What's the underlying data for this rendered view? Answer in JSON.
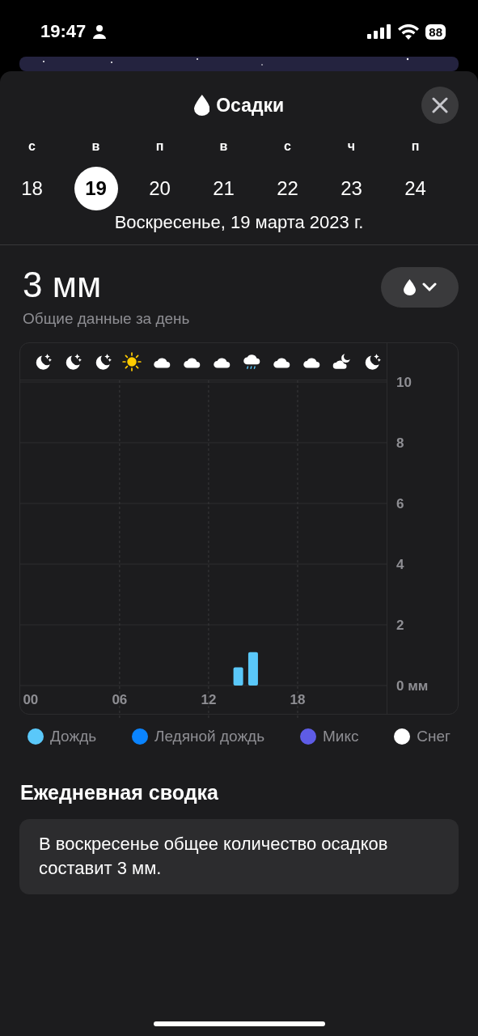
{
  "status_bar": {
    "time": "19:47",
    "battery": "88"
  },
  "sheet": {
    "title": "Осадки"
  },
  "days": [
    {
      "letter": "с",
      "number": "18",
      "selected": false
    },
    {
      "letter": "в",
      "number": "19",
      "selected": true
    },
    {
      "letter": "п",
      "number": "20",
      "selected": false
    },
    {
      "letter": "в",
      "number": "21",
      "selected": false
    },
    {
      "letter": "с",
      "number": "22",
      "selected": false
    },
    {
      "letter": "ч",
      "number": "23",
      "selected": false
    },
    {
      "letter": "п",
      "number": "24",
      "selected": false
    }
  ],
  "date": "Воскресенье, 19 марта 2023 г.",
  "total": {
    "value": "3 мм",
    "caption": "Общие данные за день"
  },
  "hourly_icons": [
    {
      "kind": "moon"
    },
    {
      "kind": "moon"
    },
    {
      "kind": "moon"
    },
    {
      "kind": "sun"
    },
    {
      "kind": "cloud"
    },
    {
      "kind": "cloud"
    },
    {
      "kind": "cloud"
    },
    {
      "kind": "rain"
    },
    {
      "kind": "cloud"
    },
    {
      "kind": "cloud"
    },
    {
      "kind": "cloud-moon"
    },
    {
      "kind": "moon"
    }
  ],
  "chart_data": {
    "type": "bar",
    "grid": true,
    "x": [
      14,
      15
    ],
    "series": [
      {
        "name": "Дождь",
        "color": "#5ac8fa",
        "values": [
          0.6,
          1.1
        ]
      },
      {
        "name": "Ледяной дождь",
        "color": "#0a84ff",
        "values": [
          0,
          0
        ]
      },
      {
        "name": "Микс",
        "color": "#5e5ce6",
        "values": [
          0,
          0
        ]
      },
      {
        "name": "Снег",
        "color": "#ffffff",
        "values": [
          0,
          0
        ]
      }
    ],
    "xlim": [
      -0.7,
      24
    ],
    "xticks": [
      {
        "value": 0,
        "label": "00"
      },
      {
        "value": 6,
        "label": "06"
      },
      {
        "value": 12,
        "label": "12"
      },
      {
        "value": 18,
        "label": "18"
      }
    ],
    "yticks": [
      {
        "value": 0,
        "label": "0 мм"
      },
      2,
      4,
      6,
      8,
      10
    ],
    "ylim": [
      0,
      10
    ]
  },
  "summary": {
    "heading": "Ежедневная сводка",
    "text": "В воскресенье общее количество осадков составит 3 мм."
  }
}
